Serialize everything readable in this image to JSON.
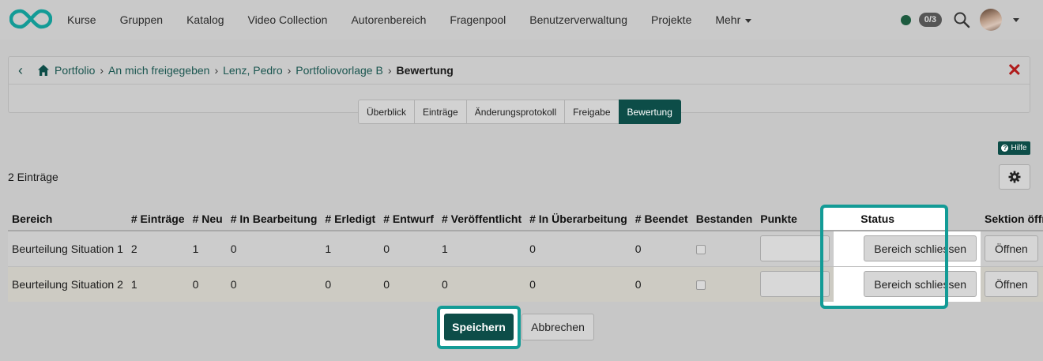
{
  "nav": {
    "items": [
      "Kurse",
      "Gruppen",
      "Katalog",
      "Video Collection",
      "Autorenbereich",
      "Fragenpool",
      "Benutzerverwaltung",
      "Projekte",
      "Mehr"
    ],
    "badge": "0/3",
    "status_color": "#1d5b3f",
    "icons": [
      "infinity-logo",
      "search-icon",
      "avatar",
      "chevron-down-icon"
    ]
  },
  "breadcrumb": {
    "items": [
      "Portfolio",
      "An mich freigegeben",
      "Lenz, Pedro",
      "Portfoliovorlage B"
    ],
    "current": "Bewertung"
  },
  "tabs": [
    "Überblick",
    "Einträge",
    "Änderungsprotokoll",
    "Freigabe",
    "Bewertung"
  ],
  "active_tab": "Bewertung",
  "help_label": "Hilfe",
  "count_label": "2 Einträge",
  "table": {
    "headers": [
      "Bereich",
      "# Einträge",
      "# Neu",
      "# In Bearbeitung",
      "# Erledigt",
      "# Entwurf",
      "# Veröffentlicht",
      "# In Überarbeitung",
      "# Beendet",
      "Bestanden",
      "Punkte",
      "Status",
      "Sektion öffnen"
    ],
    "rows": [
      {
        "bereich": "Beurteilung Situation 1",
        "eintraege": "2",
        "neu": "1",
        "in_bearbeitung": "0",
        "erledigt": "1",
        "entwurf": "0",
        "veroeffentlicht": "1",
        "in_ueberarbeitung": "0",
        "beendet": "0",
        "status_button": "Bereich schliessen",
        "open_button": "Öffnen"
      },
      {
        "bereich": "Beurteilung Situation 2",
        "eintraege": "1",
        "neu": "0",
        "in_bearbeitung": "0",
        "erledigt": "0",
        "entwurf": "0",
        "veroeffentlicht": "0",
        "in_ueberarbeitung": "0",
        "beendet": "0",
        "status_button": "Bereich schliessen",
        "open_button": "Öffnen"
      }
    ]
  },
  "actions": {
    "save": "Speichern",
    "cancel": "Abbrechen"
  },
  "colors": {
    "accent": "#0d4d48",
    "highlight": "#139b96",
    "close": "#b01b1b"
  }
}
